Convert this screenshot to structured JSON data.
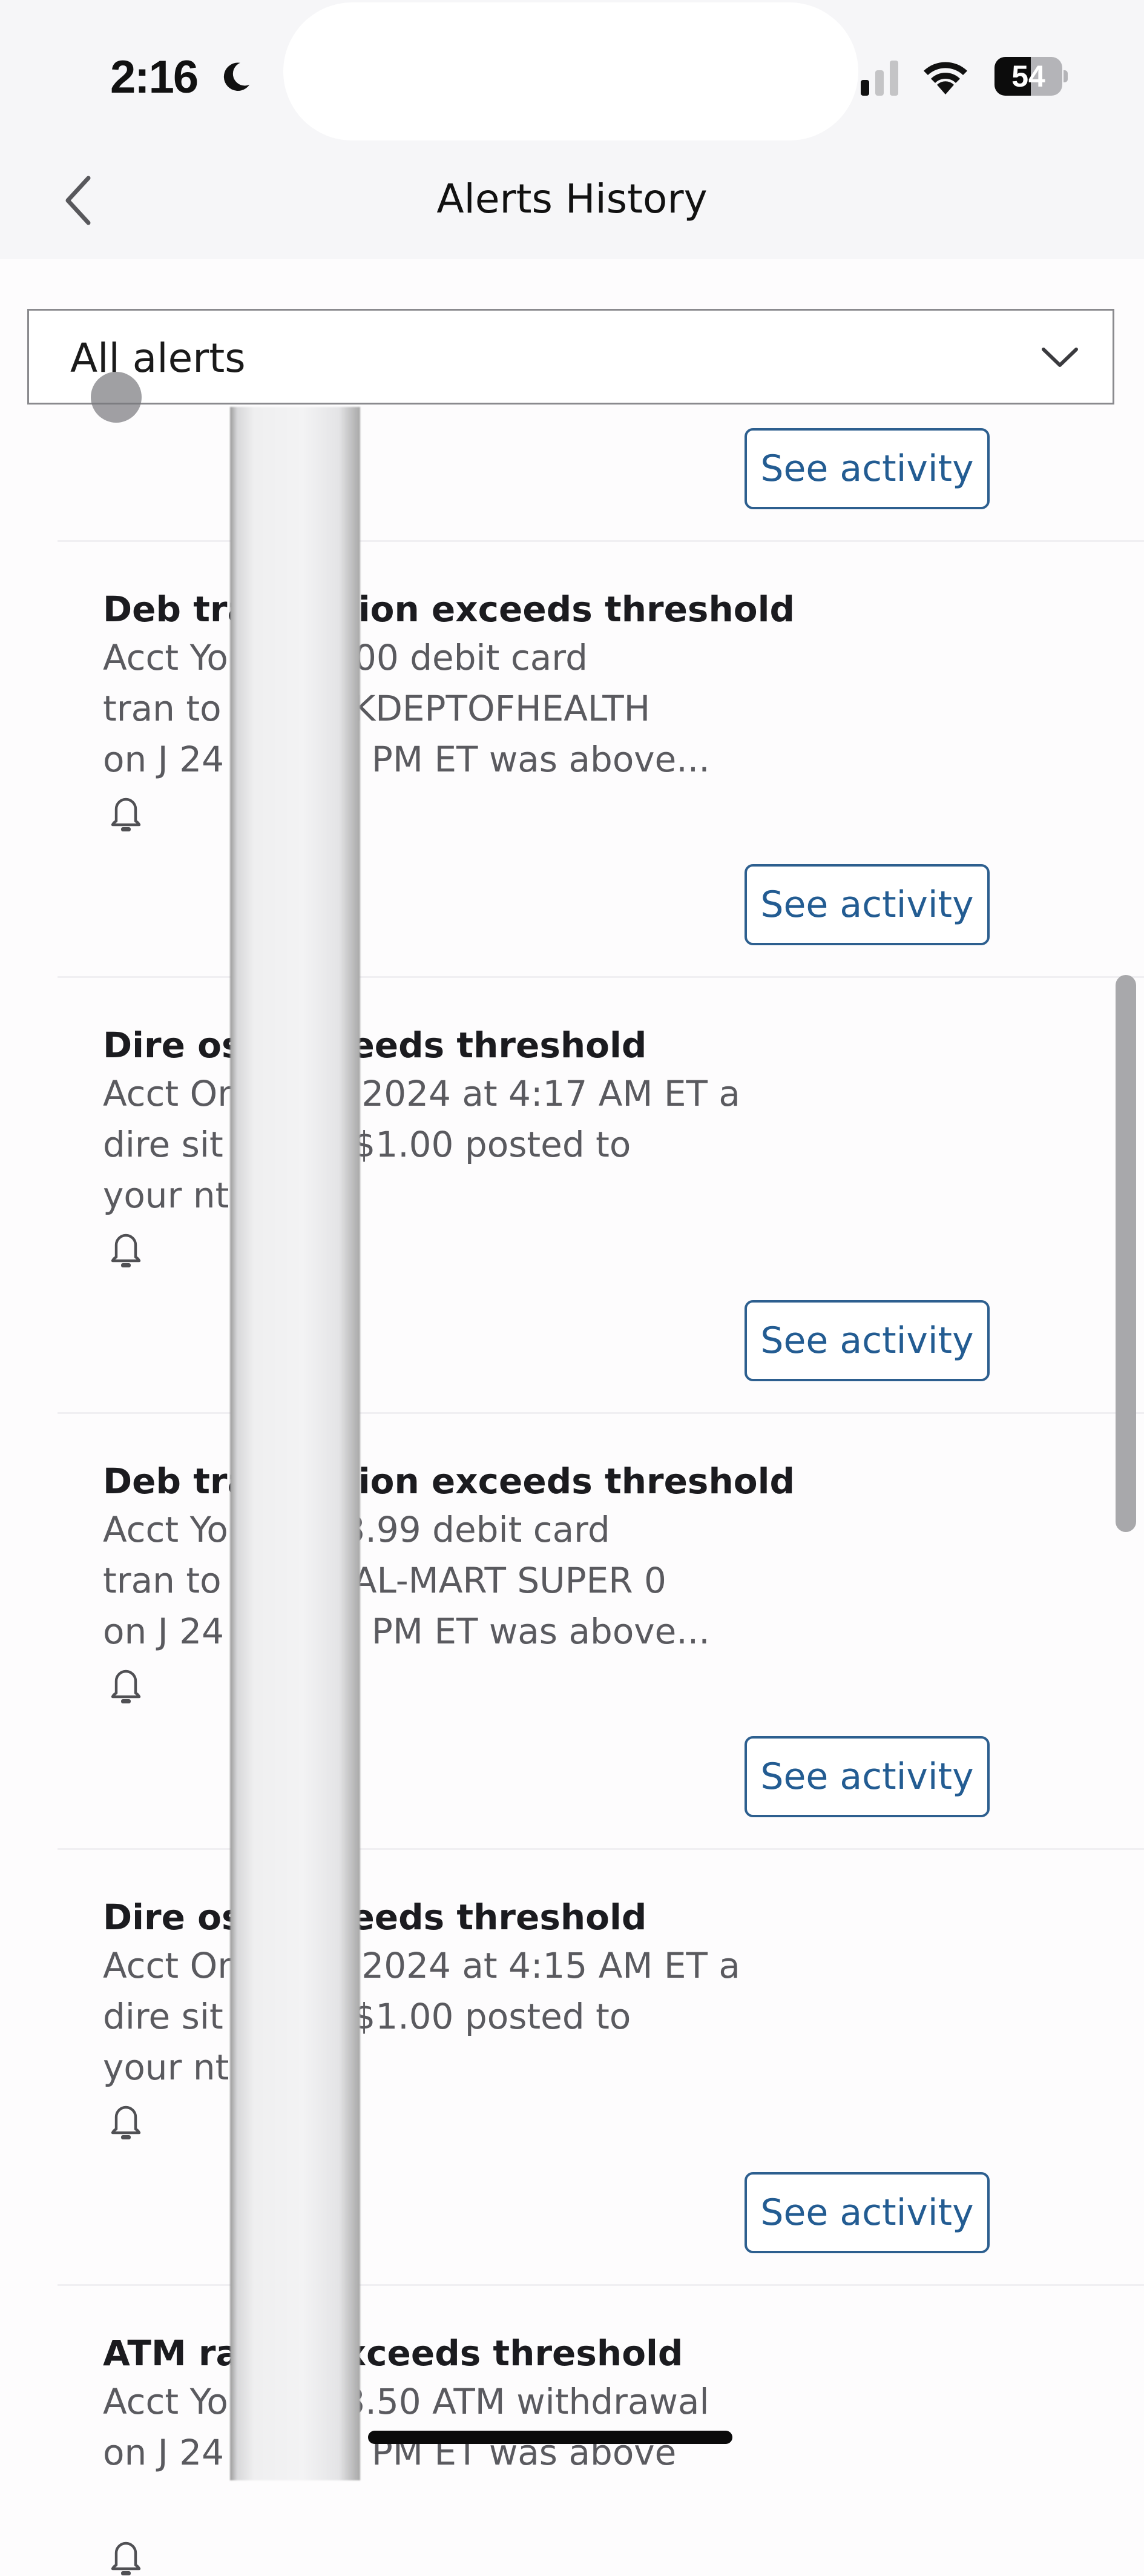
{
  "status_bar": {
    "time": "2:16",
    "focus_icon": "moon-icon",
    "signal_bars_active": 1,
    "signal_bars_total": 3,
    "wifi_icon": "wifi-icon",
    "battery_percent": 54,
    "battery_label": "54"
  },
  "nav": {
    "back_icon": "chevron-left-icon",
    "title": "Alerts History"
  },
  "filter": {
    "selected": "All alerts",
    "icon": "chevron-down-icon"
  },
  "alerts": [
    {
      "title": "",
      "body": "",
      "button": "See activity"
    },
    {
      "title": "Deb      transaction exceeds threshold",
      "body": "Acct          Your $55.00 debit card\ntran          to VCN*OKDEPTOFHEALTH\non J          24 at 5:21 PM ET was above...",
      "button": "See activity"
    },
    {
      "title": "Dire          osit exceeds threshold",
      "body": "Acct          On Jun 7, 2024 at 4:17 AM ET a\ndire          sit above $1.00 posted to\nyour          nt.",
      "button": "See activity"
    },
    {
      "title": "Deb      transaction exceeds threshold",
      "body": "Acct          Your $143.99 debit card\ntran          to WAL WAL-MART SUPER 0\non J          24 at 3:32 PM ET was above...",
      "button": "See activity"
    },
    {
      "title": "Dire          osit exceeds threshold",
      "body": "Acct          On Jun 6, 2024 at 4:15 AM ET a\ndire          sit above $1.00 posted to\nyour          nt.",
      "button": "See activity"
    },
    {
      "title": "ATM          rawal exceeds threshold",
      "body": "Acct          Your $403.50 ATM withdrawal\non J          24 at 4:05 PM ET was above",
      "button": ""
    }
  ],
  "colors": {
    "accent": "#235c92",
    "header_bg": "#f6f6f8",
    "body_text": "#5a5a5f"
  }
}
